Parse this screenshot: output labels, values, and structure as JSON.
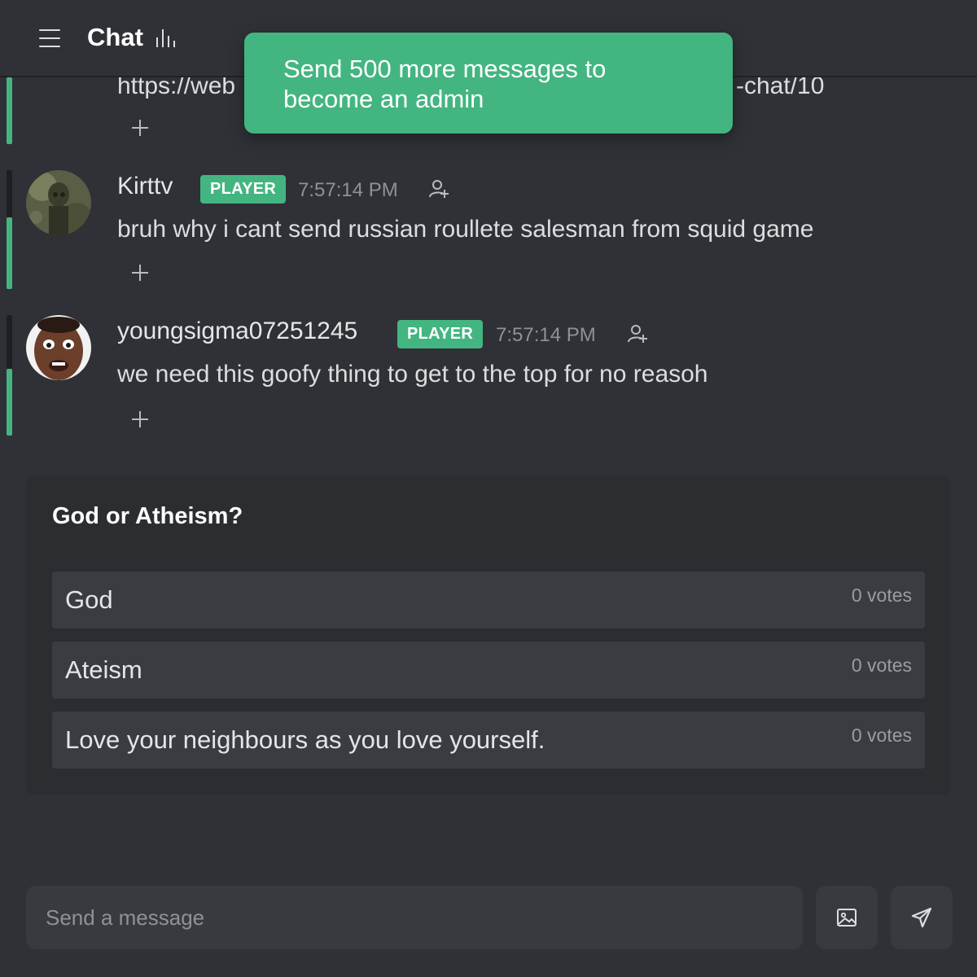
{
  "header": {
    "title": "Chat"
  },
  "toast": {
    "text": "Send 500 more messages to become an admin"
  },
  "messages": [
    {
      "text_left": "https://web",
      "text_right": "-chat/10"
    },
    {
      "name": "Kirttv",
      "badge": "PLAYER",
      "time": "7:57:14 PM",
      "text": "bruh why i cant send russian roullete salesman from squid game"
    },
    {
      "name": "youngsigma07251245",
      "badge": "PLAYER",
      "time": "7:57:14 PM",
      "text": "we need this goofy thing to get to the top for no reasoh"
    }
  ],
  "poll": {
    "question": "God or Atheism?",
    "options": [
      {
        "label": "God",
        "votes": "0 votes"
      },
      {
        "label": "Ateism",
        "votes": "0 votes"
      },
      {
        "label": "Love your neighbours as you love yourself.",
        "votes": "0 votes"
      }
    ]
  },
  "composer": {
    "placeholder": "Send a message"
  },
  "icons": {
    "menu": "hamburger-menu-icon",
    "stats": "bar-chart-icon",
    "add_user": "add-user-icon",
    "add_reaction": "plus-icon",
    "image": "image-icon",
    "send": "send-icon"
  },
  "colors": {
    "accent": "#43b581",
    "background": "#2f3136"
  }
}
